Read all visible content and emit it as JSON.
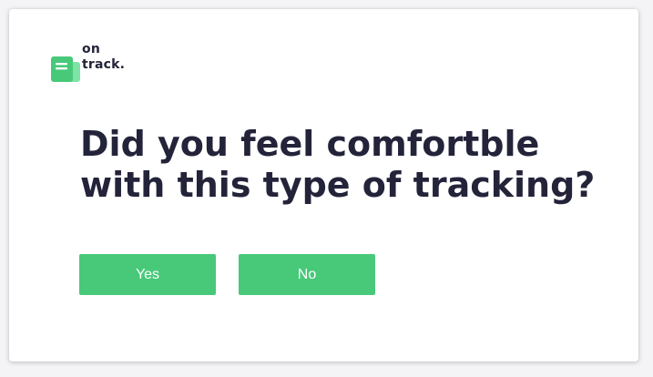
{
  "brand": {
    "line1": "on",
    "line2": "track.",
    "icon": "document-icon",
    "color": "#48c97a"
  },
  "prompt": {
    "line1": "Did you feel comfortble",
    "line2": "with this type of tracking?"
  },
  "actions": {
    "yes_label": "Yes",
    "no_label": "No"
  },
  "colors": {
    "accent": "#48c97a",
    "text": "#23233a",
    "background": "#ffffff"
  }
}
